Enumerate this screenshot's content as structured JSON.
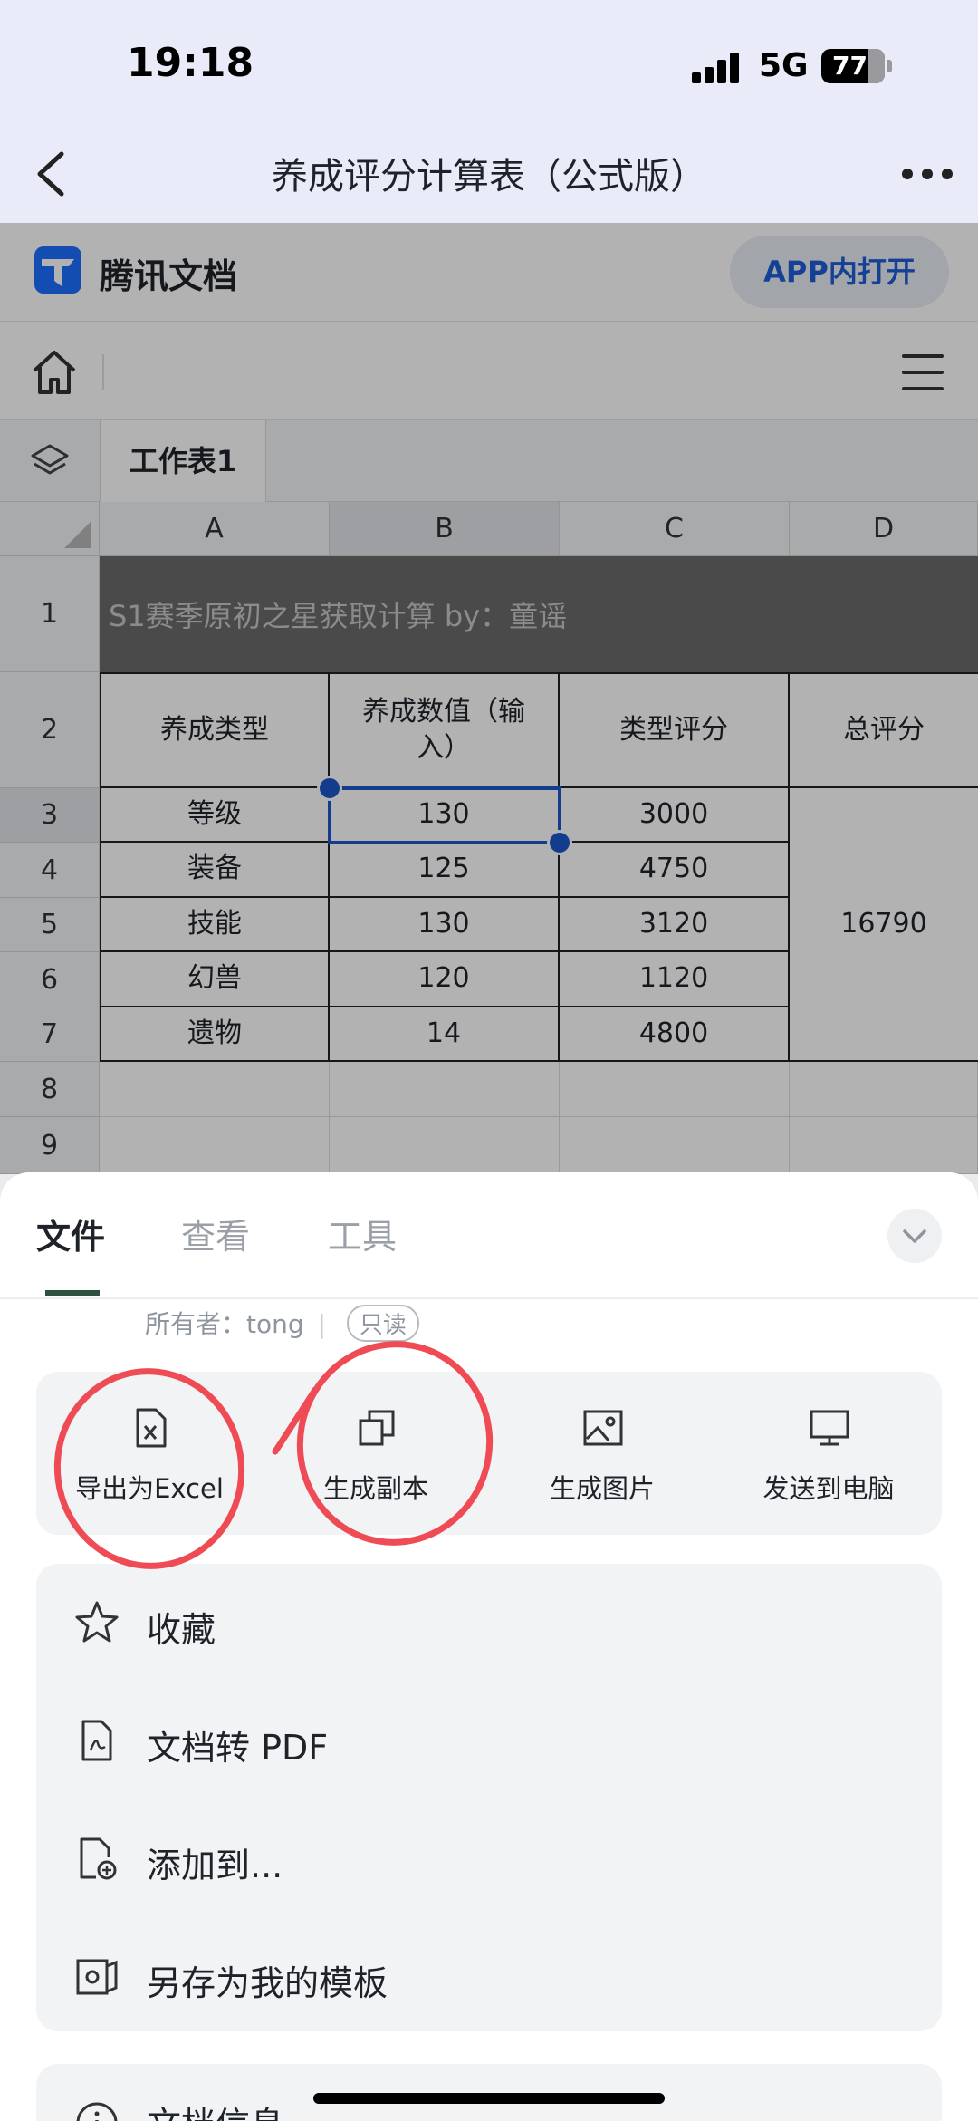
{
  "status_bar": {
    "time": "19:18",
    "network": "5G",
    "battery": "77"
  },
  "nav": {
    "title": "养成评分计算表（公式版）"
  },
  "brand": {
    "name": "腾讯文档",
    "open_app": "APP内打开"
  },
  "sheet_tabs": {
    "active": "工作表1"
  },
  "spreadsheet": {
    "columns": [
      "A",
      "B",
      "C",
      "D"
    ],
    "rows": [
      "1",
      "2",
      "3",
      "4",
      "5",
      "6",
      "7",
      "8",
      "9"
    ],
    "title": "S1赛季原初之星获取计算 by：童谣",
    "headers": [
      "养成类型",
      "养成数值（输\n入）",
      "类型评分",
      "总评分"
    ],
    "data": [
      {
        "type": "等级",
        "value": "130",
        "score": "3000"
      },
      {
        "type": "装备",
        "value": "125",
        "score": "4750"
      },
      {
        "type": "技能",
        "value": "130",
        "score": "3120"
      },
      {
        "type": "幻兽",
        "value": "120",
        "score": "1120"
      },
      {
        "type": "遗物",
        "value": "14",
        "score": "4800"
      }
    ],
    "total": "16790"
  },
  "bottom_sheet": {
    "tabs": [
      "文件",
      "查看",
      "工具"
    ],
    "owner_label": "所有者：tong",
    "separator": "|",
    "readonly": "只读",
    "actions": [
      {
        "label": "导出为Excel",
        "icon": "excel-file-icon"
      },
      {
        "label": "生成副本",
        "icon": "copy-icon"
      },
      {
        "label": "生成图片",
        "icon": "image-icon"
      },
      {
        "label": "发送到电脑",
        "icon": "monitor-icon"
      }
    ],
    "menu": [
      {
        "label": "收藏",
        "icon": "star-icon"
      },
      {
        "label": "文档转 PDF",
        "icon": "pdf-file-icon"
      },
      {
        "label": "添加到...",
        "icon": "add-to-file-icon"
      },
      {
        "label": "另存为我的模板",
        "icon": "template-icon"
      }
    ],
    "partial_item": {
      "label": "文档信息",
      "icon": "info-icon"
    }
  },
  "colors": {
    "accent": "#1e56c9",
    "annotation": "#ef4b55",
    "title_cell": "#6b6b6b"
  }
}
